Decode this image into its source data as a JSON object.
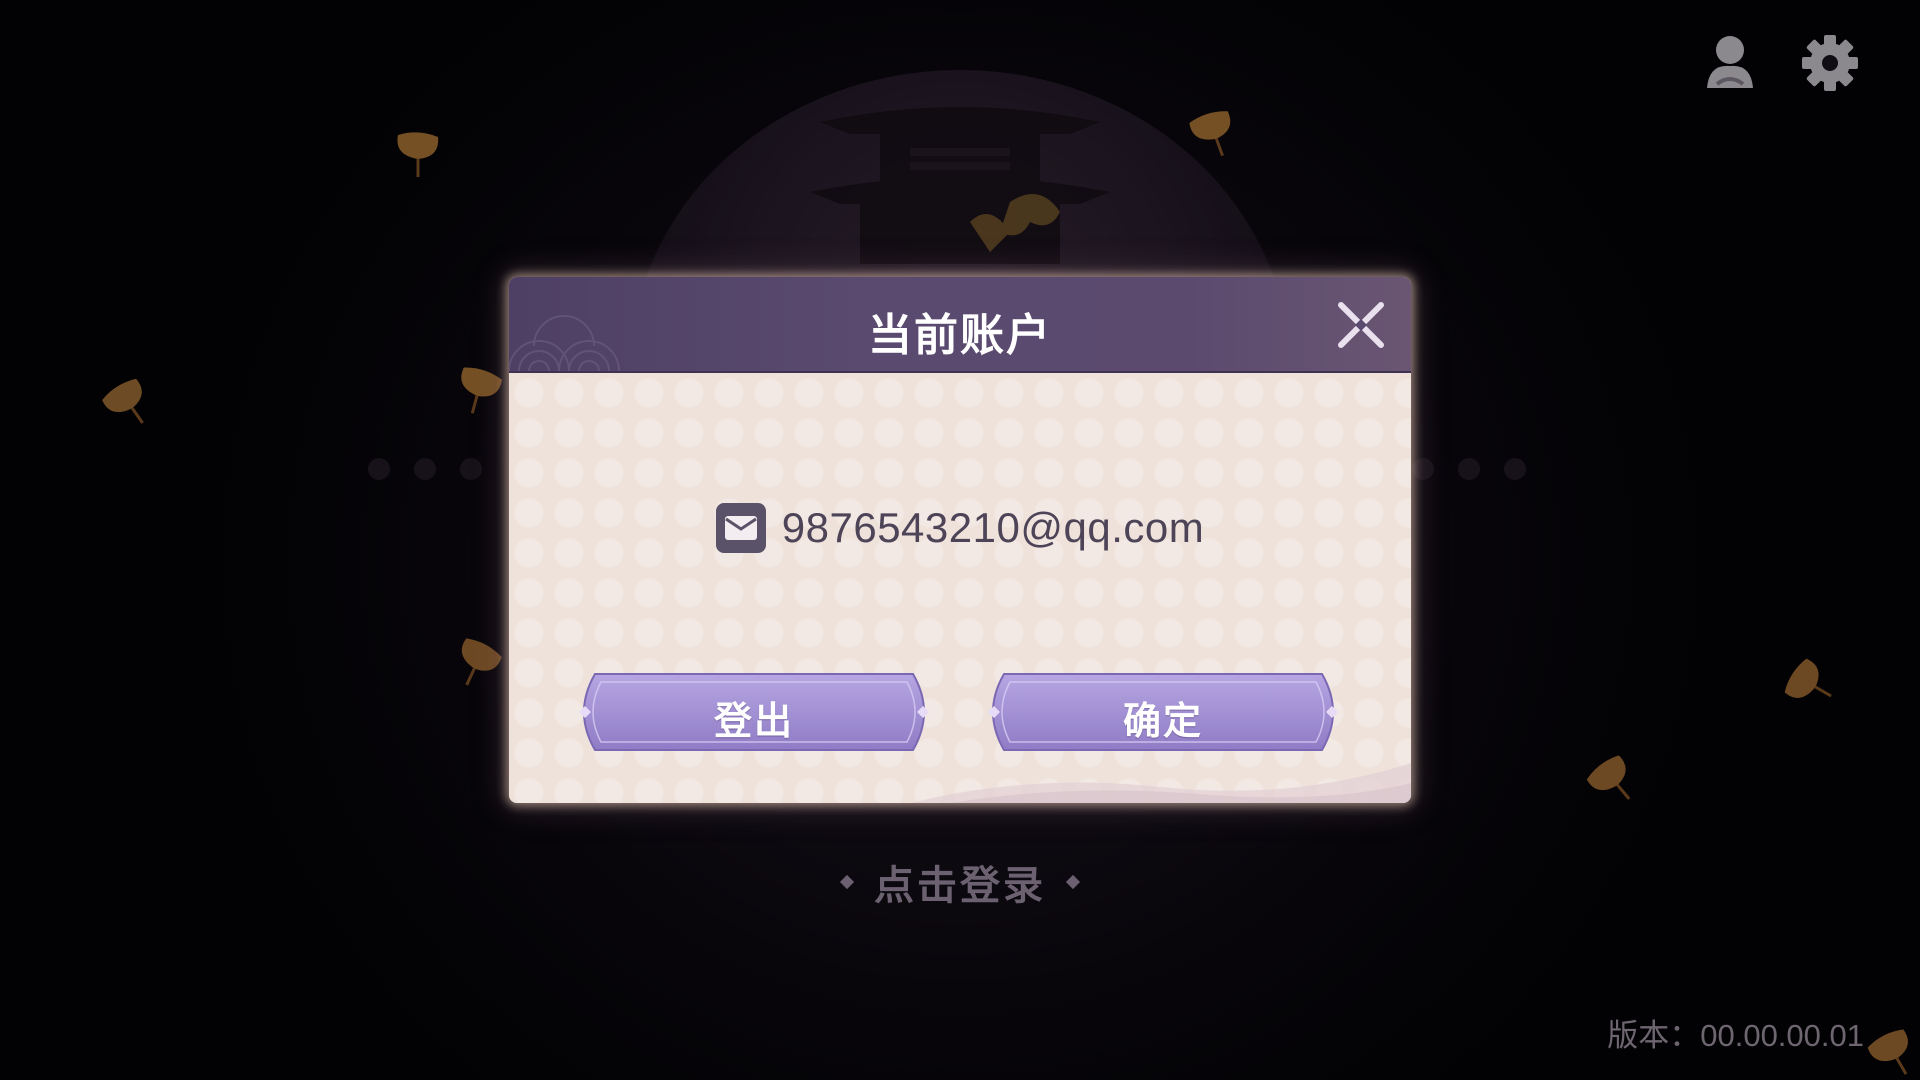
{
  "dialog": {
    "title": "当前账户",
    "account_email": "9876543210@qq.com",
    "logout_label": "登出",
    "confirm_label": "确定"
  },
  "login_hint": "点击登录",
  "version_text": "版本：00.00.00.01",
  "icons": {
    "account": "account-icon",
    "settings": "gear-icon",
    "close": "close-icon",
    "mail": "mail-icon"
  },
  "colors": {
    "header": "#574768",
    "body": "#efe2db",
    "button": "#9a87cc",
    "leaf": "#b8813d"
  }
}
